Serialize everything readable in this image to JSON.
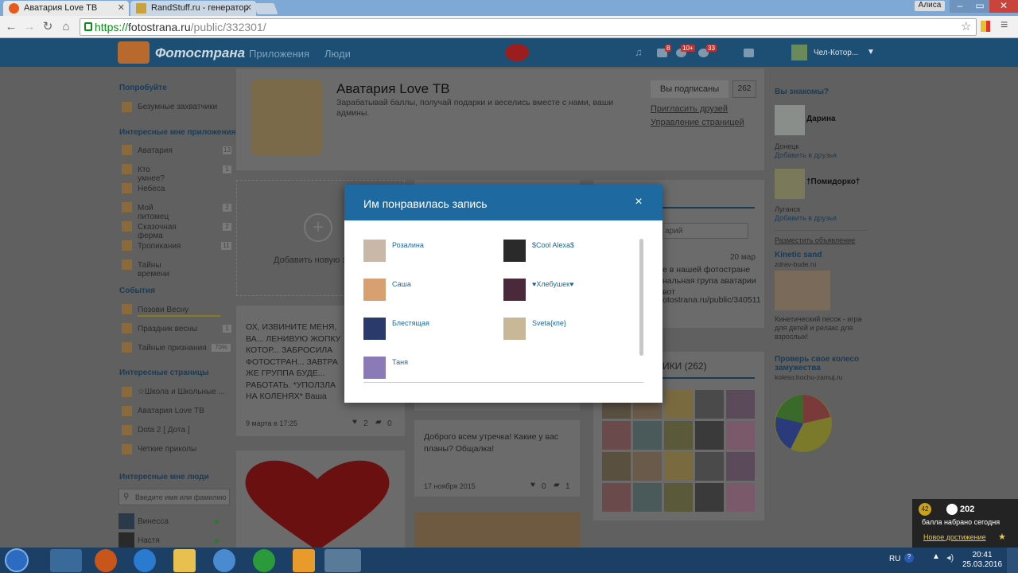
{
  "browser": {
    "tabs": [
      {
        "title": "Аватария Love ТВ",
        "active": true
      },
      {
        "title": "RandStuff.ru - генератор",
        "active": false
      }
    ],
    "profile": "Алиса",
    "url_scheme": "https://",
    "url_host": "fotostrana.ru",
    "url_path": "/public/332301/"
  },
  "site": {
    "logo": "Фотострана",
    "nav": [
      "Приложения",
      "Люди"
    ],
    "badges": {
      "feed": "8",
      "games": "10+",
      "notifications": "33"
    },
    "user": "Чел-Котор..."
  },
  "left": {
    "try_title": "Попробуйте",
    "try_item": "Безумные захватчики",
    "apps_title": "Интересные мне приложения",
    "apps": [
      {
        "label": "Аватария",
        "count": "13"
      },
      {
        "label": "Кто умнее?",
        "count": "1"
      },
      {
        "label": "Небеса",
        "count": ""
      },
      {
        "label": "Мой питомец",
        "count": "2"
      },
      {
        "label": "Сказочная ферма",
        "count": "2"
      },
      {
        "label": "Тропикания",
        "count": "11"
      },
      {
        "label": "Тайны времени",
        "count": ""
      }
    ],
    "events_title": "События",
    "events": [
      {
        "label": "Позови Весну",
        "count": ""
      },
      {
        "label": "Праздник весны",
        "count": "1"
      },
      {
        "label": "Тайные признания",
        "count": "70%"
      }
    ],
    "pages_title": "Интересные страницы",
    "pages": [
      "☆Школа и Школьные ...",
      "Аватария Love ТВ",
      "Dota 2 [ Дота ]",
      "Четкие приколы"
    ],
    "people_title": "Интересные мне люди",
    "people_search_placeholder": "Введите имя или фамилию",
    "people": [
      "Винесса",
      "Настя"
    ]
  },
  "group": {
    "name": "Аватария Love ТВ",
    "description": "Зарабатывай баллы, получай подарки и веселись вместе с нами, ваши админы.",
    "subscribed_label": "Вы подписаны",
    "subscribers_count": "262",
    "invite_link": "Пригласить друзей",
    "manage_link": "Управление страницей",
    "add_photo_label": "Добавить новую за",
    "post1_text": "ОХ, ИЗВИНИТЕ МЕНЯ, ВА... ЛЕНИВУЮ ЖОПКУ КОТОР... ЗАБРОСИЛА ФОТОСТРАН... ЗАВТРА ЖЕ ГРУППА БУДЕ... РАБОТАТЬ. *УПОЛЗЛА НА КОЛЕНЯХ* Ваша ленивая Чёрная Кош...",
    "post1_date": "9 марта в 17:25",
    "post1_likes": "2",
    "post1_comments": "0",
    "post2_text": "Доброго всем утречка! Какие у вас планы? Общалка!",
    "post2_date": "17 ноября 2015",
    "post2_likes": "0",
    "post2_comments": "1",
    "comment_placeholder": "арий",
    "post_date_right": "20 мар",
    "post_right_text": "е в нашей фотостране нальная групa аватарии вот",
    "post_right_link": "otostrana.ru/public/340511",
    "members_title": "ИКИ (262)"
  },
  "right": {
    "know_title": "Вы знакомы?",
    "people": [
      {
        "name": "Дарина",
        "city": "Донецк",
        "action": "Добавить в друзья"
      },
      {
        "name": "†Помидорко†",
        "city": "Луганск",
        "action": "Добавить в друзья"
      }
    ],
    "ad_link": "Разместить объявление",
    "ad1_title": "Kinetic sand",
    "ad1_site": "zdrav-bude.ru",
    "ad1_text": "Кинетический песок - игра для детей и релакс для взрослых!",
    "ad2_title": "Проверь свое колесо замужества",
    "ad2_site": "koleso.hochu-zamuj.ru"
  },
  "modal": {
    "title": "Им понравилась запись",
    "close": "×",
    "likers": [
      "Розалина",
      "$Cool Alexa$",
      "Саша",
      "♥Хлебушек♥",
      "Блестящая",
      "Sveta{кпе}",
      "Таня"
    ]
  },
  "notification": {
    "level": "42",
    "points": "202",
    "text": "балла набрано сегодня",
    "link": "Новое достижение"
  },
  "taskbar": {
    "lang": "RU",
    "time": "20:41",
    "date": "25.03.2016"
  },
  "colors": {
    "accent": "#1e6aa0",
    "header": "#1c4f73",
    "taskbar": "#1c3f66"
  }
}
